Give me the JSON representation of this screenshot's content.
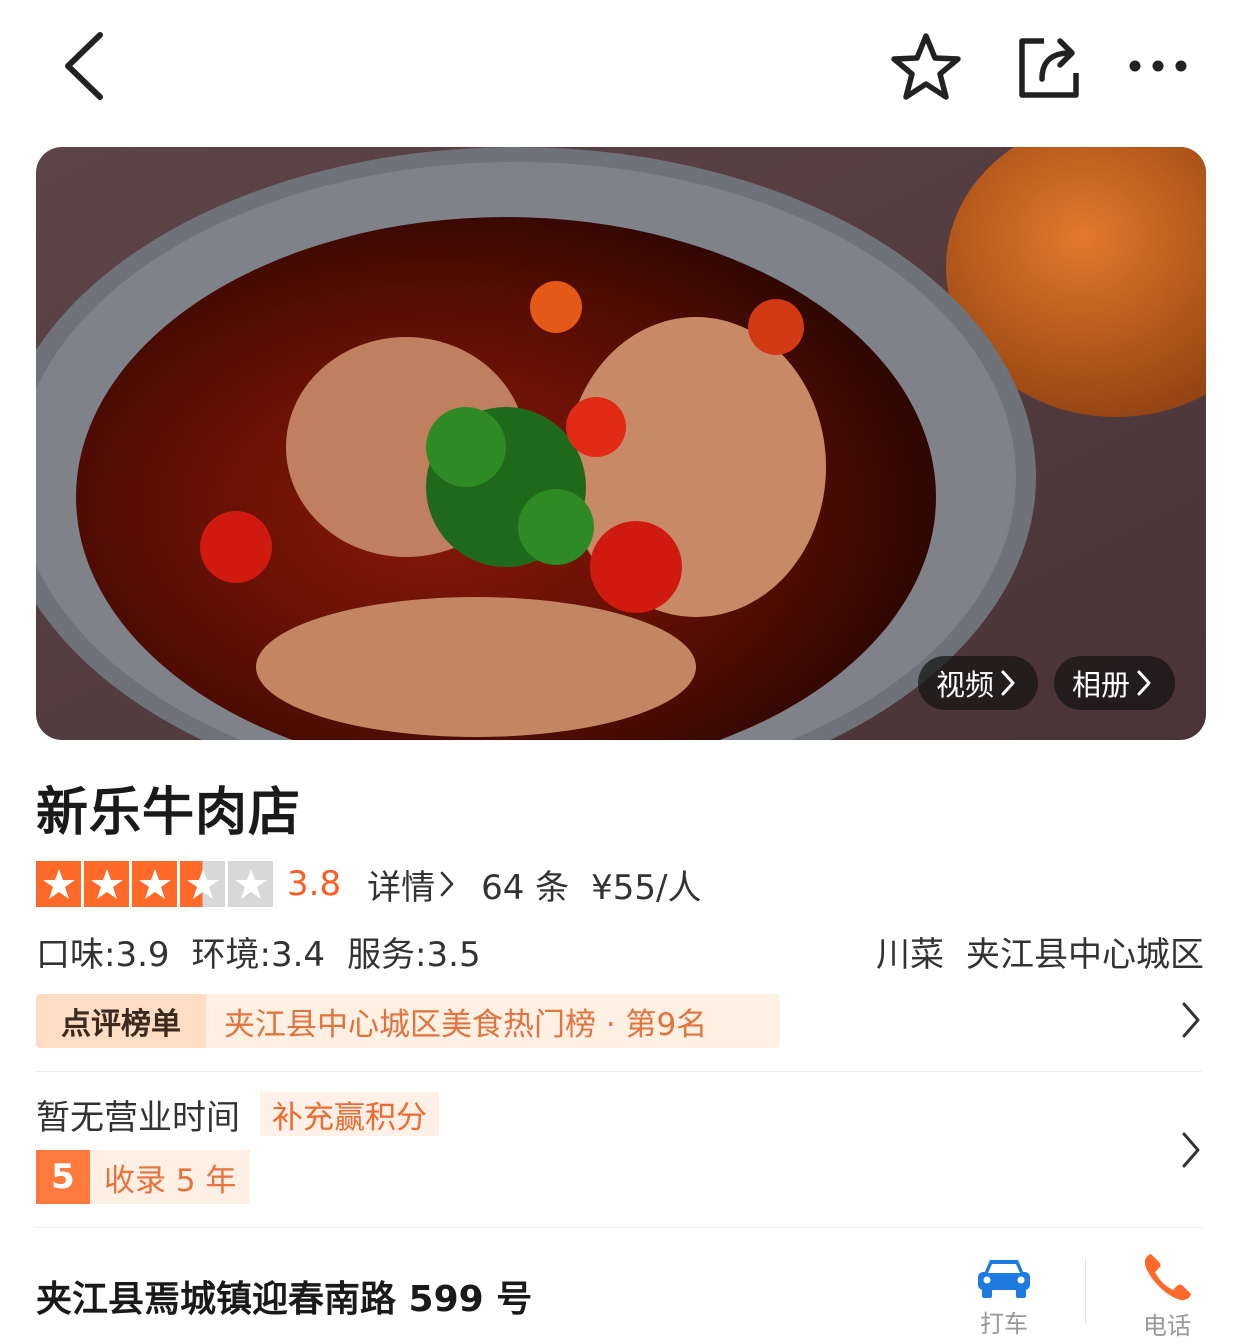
{
  "topbar": {
    "back": "back-icon",
    "favorite": "star-outline-icon",
    "share": "share-icon",
    "more": "more-dots-icon"
  },
  "hero": {
    "video_label": "视频",
    "album_label": "相册"
  },
  "shop": {
    "name": "新乐牛肉店",
    "rating_stars": 3.5,
    "score": "3.8",
    "detail_label": "详情",
    "review_count": "64 条",
    "avg_price": "¥55/人"
  },
  "sub_scores": {
    "taste": "口味:3.9",
    "environment": "环境:3.4",
    "service": "服务:3.5"
  },
  "tags": {
    "cuisine": "川菜",
    "area": "夹江县中心城区"
  },
  "ranking": {
    "logo": "点评榜单",
    "text": "夹江县中心城区美食热门榜 · 第9名"
  },
  "hours": {
    "text": "暂无营业时间",
    "tag": "补充赢积分"
  },
  "years": {
    "number": "5",
    "text": "收录 5 年"
  },
  "address": "夹江县焉城镇迎春南路 599 号",
  "actions": {
    "taxi_label": "打车",
    "phone_label": "电话"
  },
  "colors": {
    "accent": "#ff5b24",
    "tag_bg": "#fff0e4",
    "tag_text": "#e2733e"
  }
}
